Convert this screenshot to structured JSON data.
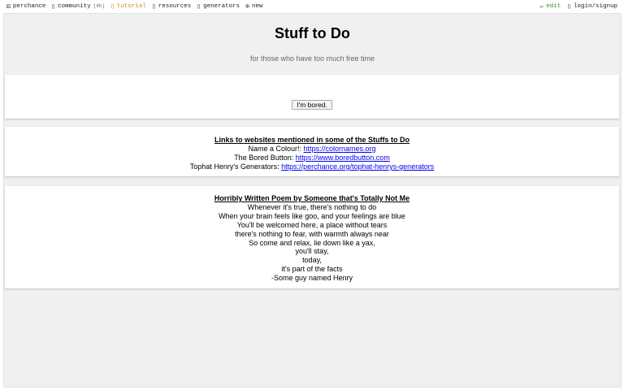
{
  "nav": {
    "left": [
      {
        "icon": "dice-icon",
        "glyph": "⚄",
        "label": "perchance"
      },
      {
        "icon": "community-icon",
        "glyph": "▯",
        "label": "community",
        "count": "(4h)"
      },
      {
        "icon": "tutorial-icon",
        "glyph": "▯",
        "label": "tutorial"
      },
      {
        "icon": "resources-icon",
        "glyph": "▯",
        "label": "resources"
      },
      {
        "icon": "generators-icon",
        "glyph": "▯",
        "label": "generators"
      },
      {
        "icon": "new-icon",
        "glyph": "⊕",
        "label": "new"
      }
    ],
    "right": [
      {
        "icon": "edit-icon",
        "glyph": "✏",
        "label": "edit"
      },
      {
        "icon": "login-icon",
        "glyph": "▯",
        "label": "login/signup"
      }
    ]
  },
  "header": {
    "title": "Stuff to Do",
    "subtitle": "for those who have too much free time"
  },
  "bored_button": {
    "label": "I'm bored."
  },
  "links_card": {
    "title": "Links to websites mentioned in some of the Stuffs to Do",
    "items": [
      {
        "label": "Name a Colour!:",
        "url": "https://colornames.org"
      },
      {
        "label": "The Bored Button:",
        "url": "https://www.boredbutton.com"
      },
      {
        "label": "Tophat Henry's Generators:",
        "url": "https://perchance.org/tophat-henrys-generators"
      }
    ]
  },
  "poem_card": {
    "title": "Horribly Written Poem by Someone that's Totally Not Me",
    "lines": [
      "Whenever it's true, there's nothing to do",
      "When your brain feels like goo, and your feelings are blue",
      "You'll be welcomed here, a place without tears",
      "there's nothing to fear, with warmth always near",
      "So come and relax, lie down like a yax,",
      "you'll stay,",
      "today,",
      "it's part of the facts",
      "-Some guy named Henry"
    ]
  },
  "colors": {
    "accent_tutorial": "#d08a2a",
    "accent_edit": "#3a8a2e",
    "link": "#0000ee",
    "background": "#f0f0f0"
  }
}
